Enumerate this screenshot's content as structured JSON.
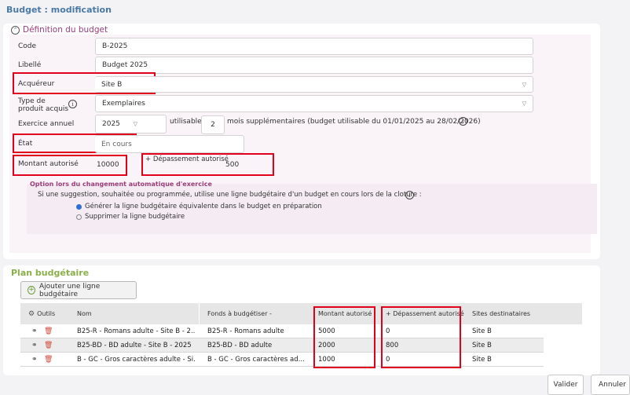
{
  "page": {
    "title": "Budget : modification"
  },
  "definition": {
    "section_title": "Définition du budget",
    "code": {
      "label": "Code",
      "value": "B-2025"
    },
    "libelle": {
      "label": "Libellé",
      "value": "Budget 2025"
    },
    "acquereur": {
      "label": "Acquéreur",
      "value": "Site B"
    },
    "type_produit": {
      "label_line1": "Type de",
      "label_line2": "produit acquis",
      "value": "Exemplaires"
    },
    "exercice": {
      "label": "Exercice annuel",
      "year": "2025",
      "utilisable_label": "utilisable",
      "months": "2",
      "months_text": "mois supplémentaires (budget utilisable du 01/01/2025 au 28/02/2026)"
    },
    "etat": {
      "label": "État",
      "value": "En cours"
    },
    "montant": {
      "label": "Montant autorisé",
      "value": "10000"
    },
    "depassement": {
      "label": "+ Dépassement autorisé",
      "value": "500"
    },
    "option": {
      "title": "Option lors du changement automatique d'exercice",
      "question": "Si une suggestion, souhaitée ou programmée, utilise une ligne budgétaire d'un budget en cours lors de la cloture :",
      "choices": [
        {
          "label": "Générer la ligne budgétaire équivalente dans le budget en préparation",
          "selected": true
        },
        {
          "label": "Supprimer la ligne budgétaire",
          "selected": false
        }
      ]
    }
  },
  "plan": {
    "title": "Plan budgétaire",
    "add_button": "Ajouter une ligne budgétaire",
    "columns": {
      "outils": "Outils",
      "nom": "Nom",
      "fonds": "Fonds à budgétiser -",
      "montant": "Montant autorisé",
      "depassement": "+ Dépassement autorisé",
      "sites": "Sites destinataires"
    },
    "rows": [
      {
        "nom": "B25-R - Romans adulte - Site B - 2...",
        "fonds": "B25-R - Romans adulte",
        "montant": "5000",
        "depassement": "0",
        "sites": "Site B"
      },
      {
        "nom": "B25-BD - BD adulte - Site B - 2025",
        "fonds": "B25-BD - BD adulte",
        "montant": "2000",
        "depassement": "800",
        "sites": "Site B"
      },
      {
        "nom": "B - GC - Gros caractères adulte - Si...",
        "fonds": "B - GC - Gros caractères ad...",
        "montant": "1000",
        "depassement": "0",
        "sites": "Site B"
      }
    ]
  },
  "footer": {
    "valider": "Valider",
    "annuler": "Annuler"
  },
  "colors": {
    "title_blue": "#4a7aa6",
    "section_purple": "#9b3d7a",
    "plan_green": "#8ab04a",
    "highlight_red": "#e0001b"
  }
}
